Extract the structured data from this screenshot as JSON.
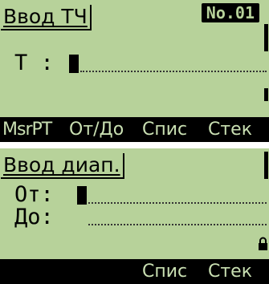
{
  "screen1": {
    "title": "Ввод ТЧ",
    "badge": "No.01",
    "field_label": "Т :",
    "softkeys": [
      "MsrPT",
      "От/До",
      "Спис",
      "Стек"
    ]
  },
  "screen2": {
    "title": "Ввод диап.",
    "from_label": "От:",
    "to_label": "До:",
    "softkeys": [
      "Спис",
      "Стек"
    ]
  }
}
